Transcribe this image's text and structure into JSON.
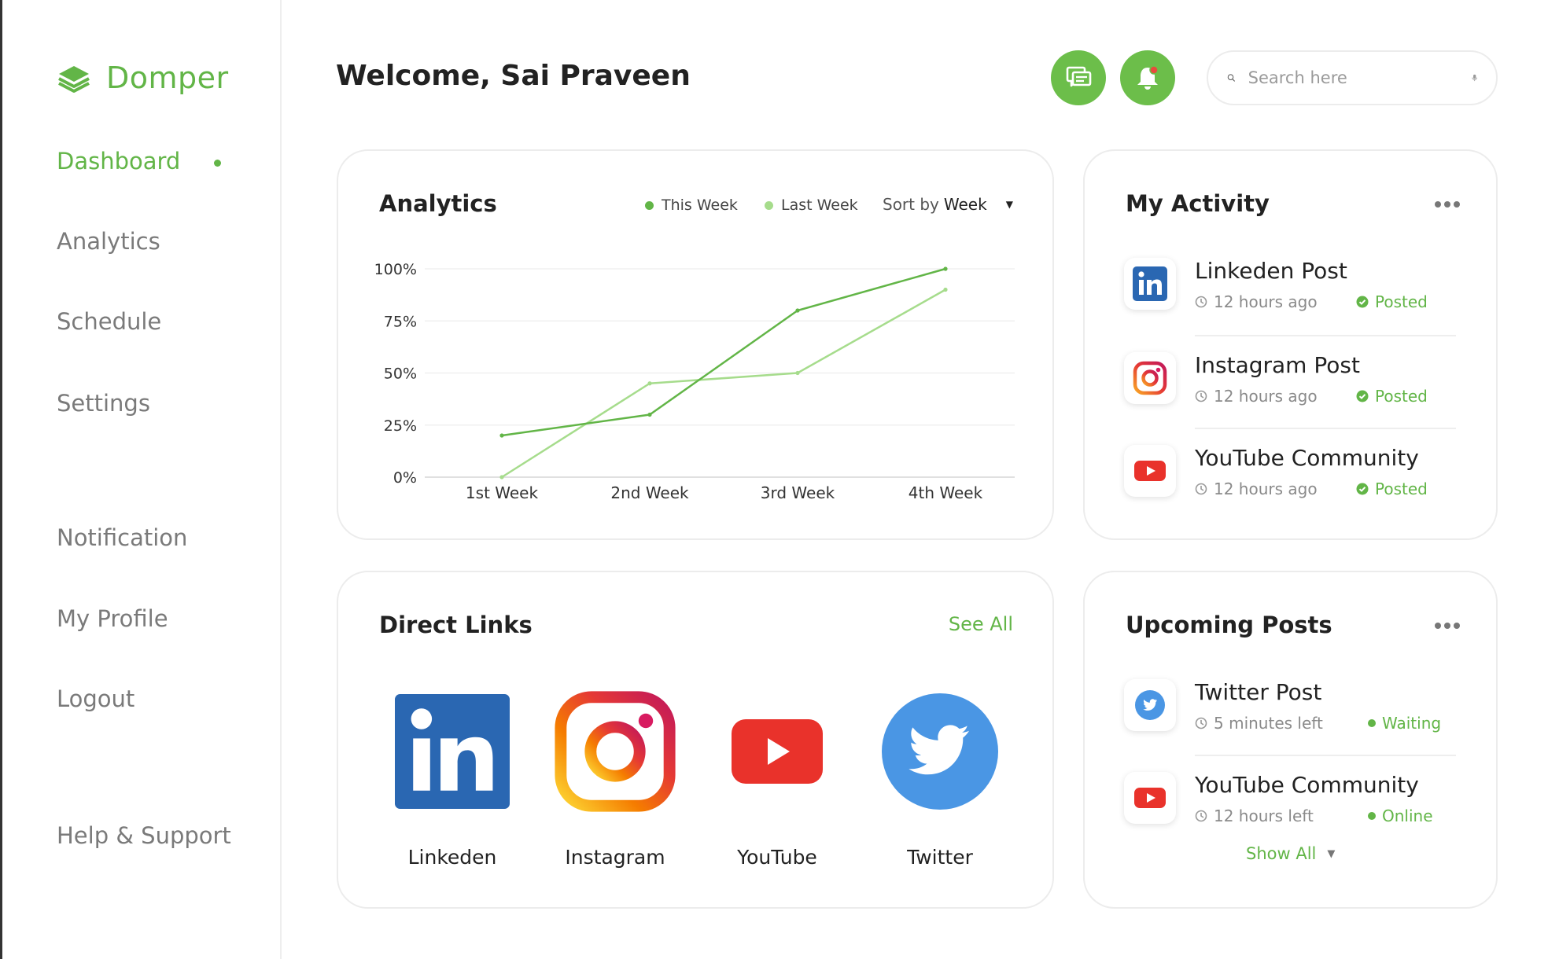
{
  "brand": {
    "name": "Domper"
  },
  "sidebar": {
    "items": [
      {
        "label": "Dashboard",
        "active": true
      },
      {
        "label": "Analytics"
      },
      {
        "label": "Schedule"
      },
      {
        "label": "Settings"
      },
      {
        "label": "Notification"
      },
      {
        "label": "My Profile"
      },
      {
        "label": "Logout"
      },
      {
        "label": "Help & Support"
      }
    ]
  },
  "header": {
    "welcome": "Welcome, Sai Praveen",
    "search_placeholder": "Search here",
    "icons": [
      "chat-icon",
      "bell-icon",
      "search-icon",
      "mic-icon"
    ]
  },
  "analytics": {
    "title": "Analytics",
    "legend": [
      {
        "label": "This Week",
        "color": "#62b547"
      },
      {
        "label": "Last Week",
        "color": "#a6dc8c"
      }
    ],
    "sort_prefix": "Sort by",
    "sort_value": "Week"
  },
  "chart_data": {
    "type": "line",
    "categories": [
      "1st Week",
      "2nd Week",
      "3rd Week",
      "4th Week"
    ],
    "y_ticks": [
      "100%",
      "75%",
      "50%",
      "25%",
      "0%"
    ],
    "ylim": [
      0,
      100
    ],
    "grid": true,
    "legend_position": "top-right",
    "series": [
      {
        "name": "This Week",
        "color": "#62b547",
        "values": [
          20,
          30,
          80,
          100
        ]
      },
      {
        "name": "Last Week",
        "color": "#a6dc8c",
        "values": [
          0,
          45,
          50,
          90
        ]
      }
    ]
  },
  "activity": {
    "title": "My Activity",
    "items": [
      {
        "title": "Linkeden Post",
        "time": "12 hours ago",
        "status": "Posted",
        "icon": "linkedin-icon"
      },
      {
        "title": "Instagram Post",
        "time": "12 hours ago",
        "status": "Posted",
        "icon": "instagram-icon"
      },
      {
        "title": "YouTube Community",
        "time": "12 hours ago",
        "status": "Posted",
        "icon": "youtube-icon"
      }
    ]
  },
  "direct_links": {
    "title": "Direct Links",
    "see_all": "See All",
    "items": [
      {
        "label": "Linkeden",
        "icon": "linkedin-icon"
      },
      {
        "label": "Instagram",
        "icon": "instagram-icon"
      },
      {
        "label": "YouTube",
        "icon": "youtube-icon"
      },
      {
        "label": "Twitter",
        "icon": "twitter-icon"
      }
    ]
  },
  "upcoming": {
    "title": "Upcoming Posts",
    "items": [
      {
        "title": "Twitter Post",
        "time": "5 minutes left",
        "status": "Waiting",
        "icon": "twitter-icon"
      },
      {
        "title": "YouTube Community",
        "time": "12 hours left",
        "status": "Online",
        "icon": "youtube-icon"
      }
    ],
    "show_all": "Show All"
  },
  "colors": {
    "accent": "#62b547",
    "accent_light": "#a6dc8c",
    "text": "#222222",
    "muted": "#7a7a7a",
    "card_border": "#ececec"
  }
}
